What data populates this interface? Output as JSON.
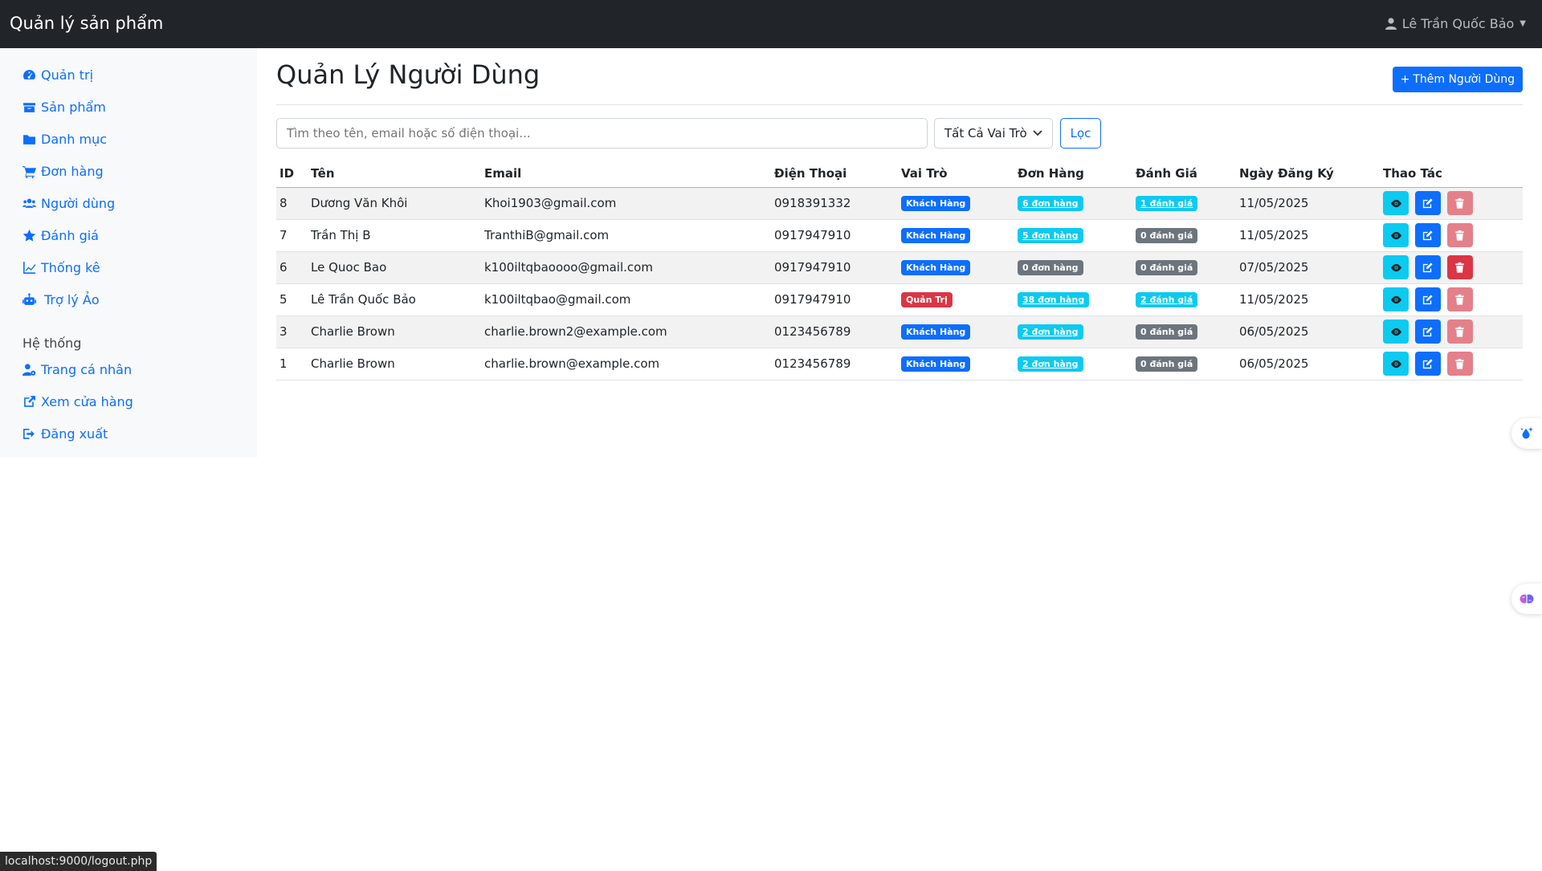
{
  "navbar": {
    "brand": "Quản lý sản phẩm",
    "user_name": "Lê Trần Quốc Bảo"
  },
  "sidebar": {
    "items": [
      {
        "label": "Quản trị",
        "icon": "dashboard-icon"
      },
      {
        "label": "Sản phẩm",
        "icon": "box-icon"
      },
      {
        "label": "Danh mục",
        "icon": "folder-icon"
      },
      {
        "label": "Đơn hàng",
        "icon": "cart-icon"
      },
      {
        "label": "Người dùng",
        "icon": "users-icon"
      },
      {
        "label": "Đánh giá",
        "icon": "star-icon"
      },
      {
        "label": "Thống kê",
        "icon": "chart-line-icon"
      },
      {
        "label": "Trợ lý Ảo",
        "icon": "robot-icon"
      }
    ],
    "system_heading": "Hệ thống",
    "system_items": [
      {
        "label": "Trang cá nhân",
        "icon": "user-gear-icon"
      },
      {
        "label": "Xem cửa hàng",
        "icon": "external-link-icon"
      },
      {
        "label": "Đăng xuất",
        "icon": "sign-out-icon"
      }
    ]
  },
  "main": {
    "title": "Quản Lý Người Dùng",
    "add_button": "Thêm Người Dùng",
    "search_placeholder": "Tìm theo tên, email hoặc số điện thoại...",
    "role_filter": "Tất Cả Vai Trò",
    "filter_button": "Lọc"
  },
  "table": {
    "headers": [
      "ID",
      "Tên",
      "Email",
      "Điện Thoại",
      "Vai Trò",
      "Đơn Hàng",
      "Đánh Giá",
      "Ngày Đăng Ký",
      "Thao Tác"
    ],
    "rows": [
      {
        "id": "8",
        "name": "Dương Văn Khôi",
        "email": "Khoi1903@gmail.com",
        "phone": "0918391332",
        "role": "Khách Hàng",
        "orders": "6 đơn hàng",
        "reviews": "1 đánh giá",
        "date": "11/05/2025"
      },
      {
        "id": "7",
        "name": "Trần Thị B",
        "email": "TranthiB@gmail.com",
        "phone": "0917947910",
        "role": "Khách Hàng",
        "orders": "5 đơn hàng",
        "reviews": "0 đánh giá",
        "date": "11/05/2025"
      },
      {
        "id": "6",
        "name": "Le Quoc Bao",
        "email": "k100iltqbaoooo@gmail.com",
        "phone": "0917947910",
        "role": "Khách Hàng",
        "orders": "0 đơn hàng",
        "reviews": "0 đánh giá",
        "date": "07/05/2025"
      },
      {
        "id": "5",
        "name": "Lê Trần Quốc Bảo",
        "email": "k100iltqbao@gmail.com",
        "phone": "0917947910",
        "role": "Quản Trị",
        "orders": "38 đơn hàng",
        "reviews": "2 đánh giá",
        "date": "11/05/2025"
      },
      {
        "id": "3",
        "name": "Charlie Brown",
        "email": "charlie.brown2@example.com",
        "phone": "0123456789",
        "role": "Khách Hàng",
        "orders": "2 đơn hàng",
        "reviews": "0 đánh giá",
        "date": "06/05/2025"
      },
      {
        "id": "1",
        "name": "Charlie Brown",
        "email": "charlie.brown@example.com",
        "phone": "0123456789",
        "role": "Khách Hàng",
        "orders": "2 đơn hàng",
        "reviews": "0 đánh giá",
        "date": "06/05/2025"
      }
    ]
  },
  "status_bar": {
    "url": "localhost:9000/logout.php"
  },
  "colors": {
    "primary": "#0d6efd",
    "info": "#0dcaf0",
    "secondary": "#6c757d",
    "danger": "#dc3545",
    "navbar": "#212529"
  }
}
